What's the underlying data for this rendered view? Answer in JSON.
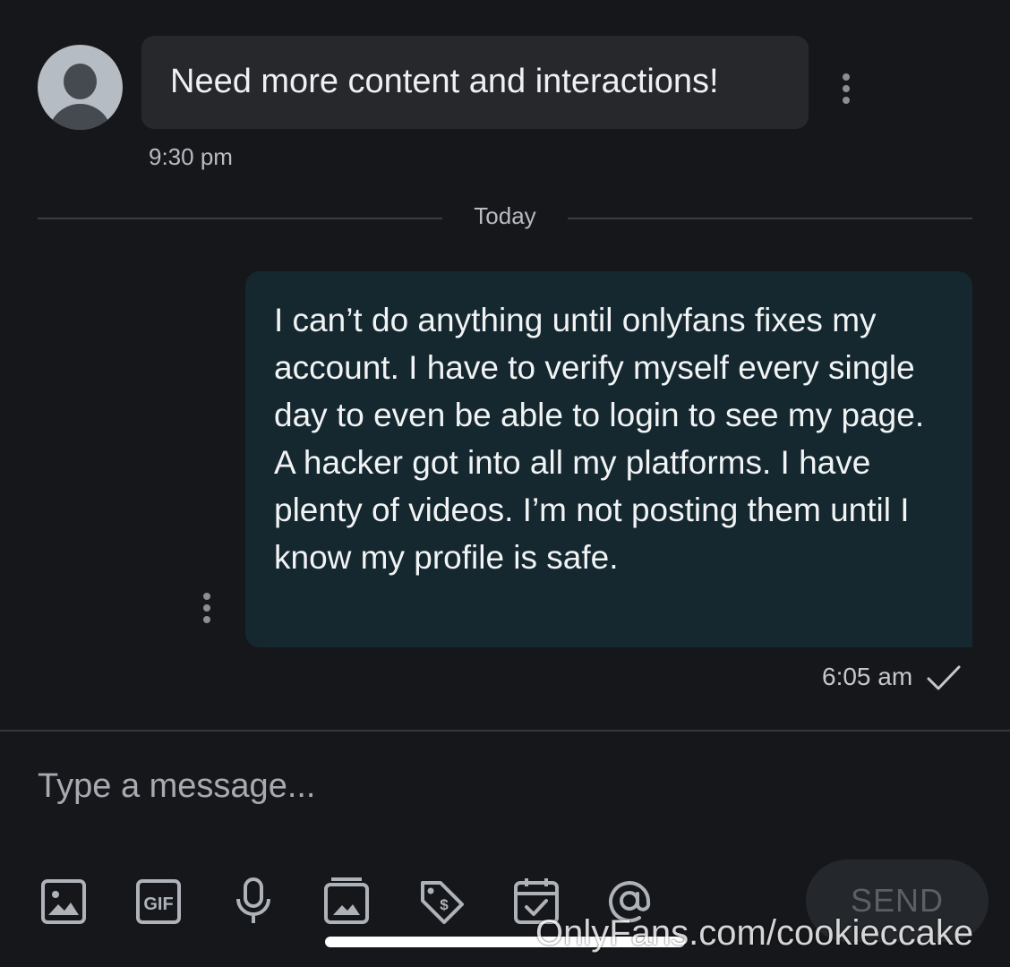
{
  "incoming": {
    "message": "Need more content and interactions!",
    "time": "9:30 pm"
  },
  "date_divider": "Today",
  "outgoing": {
    "message": "I can’t do anything until onlyfans fixes my account. I have to verify myself every single day to even be able to login to see my page. A hacker got into all my platforms. I have plenty of videos. I’m not posting them until I know my profile is safe.",
    "time": "6:05 am",
    "status_icon": "check-icon"
  },
  "composer": {
    "placeholder": "Type a message...",
    "tools": [
      "image-icon",
      "gif-icon",
      "microphone-icon",
      "vault-icon",
      "price-tag-icon",
      "calendar-icon",
      "mention-icon"
    ],
    "send_label": "SEND"
  },
  "watermark": "OnlyFans.com/cookieccake",
  "colors": {
    "background": "#16171b",
    "incoming_bubble": "#26282c",
    "outgoing_bubble": "#15282f",
    "icon": "#aeb3b9"
  }
}
